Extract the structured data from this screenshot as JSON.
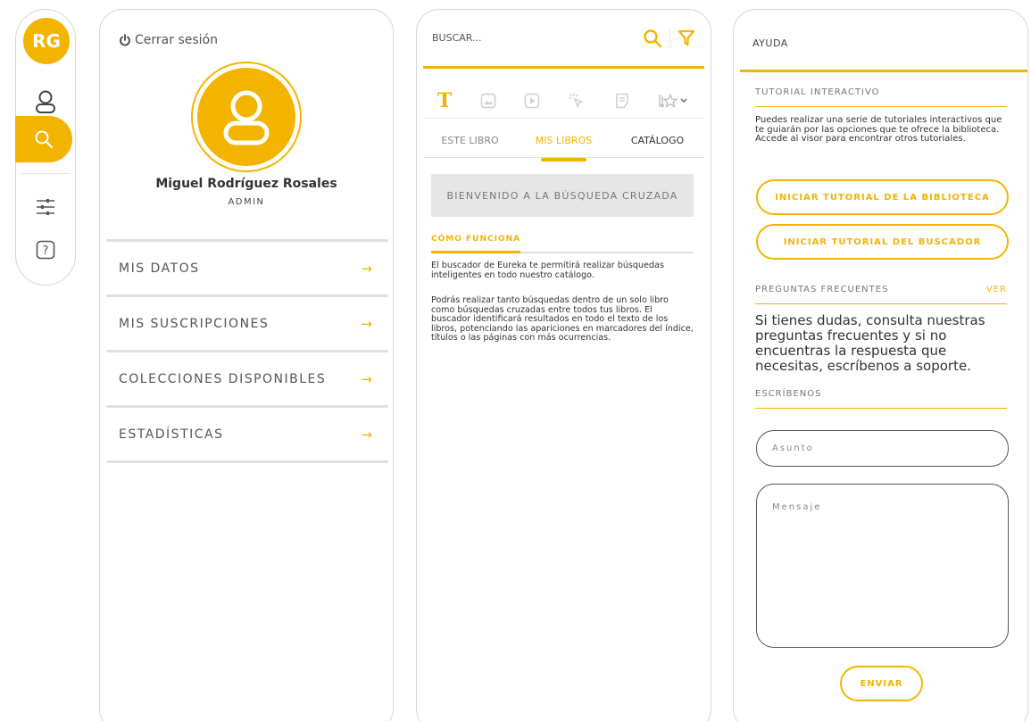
{
  "theme": {
    "accent": "#f3b400",
    "border": "#d7d7d7",
    "muted": "#777777"
  },
  "rail": {
    "initials": "RG",
    "items": [
      {
        "icon": "user-icon"
      },
      {
        "icon": "search-icon",
        "active": true
      },
      {
        "icon": "sliders-icon"
      },
      {
        "icon": "help-icon"
      }
    ]
  },
  "profile": {
    "logout_label": "Cerrar sesión",
    "name": "Miguel Rodríguez Rosales",
    "role": "ADMIN",
    "menu": [
      {
        "label": "MIS DATOS"
      },
      {
        "label": "MIS SUSCRIPCIONES"
      },
      {
        "label": "COLECCIONES DISPONIBLES"
      },
      {
        "label": "ESTADÍSTICAS"
      }
    ],
    "arrow": "→"
  },
  "search": {
    "placeholder": "BUSCAR...",
    "tools": [
      "text",
      "image",
      "video",
      "click",
      "note",
      "favorites"
    ],
    "text_tool_glyph": "T",
    "tabs": [
      {
        "label": "ESTE LIBRO"
      },
      {
        "label": "MIS LIBROS",
        "active": true
      },
      {
        "label": "CATÁLOGO"
      }
    ],
    "welcome": "BIENVENIDO A LA BÚSQUEDA CRUZADA",
    "how_title": "CÓMO FUNCIONA",
    "paragraph1": "El buscador de Eureka te permitirá realizar búsquedas inteligentes en todo nuestro catálogo.",
    "paragraph2": "Podrás realizar tanto búsquedas dentro de un solo libro como búsquedas cruzadas entre todos tus libros. El buscador identificará resultados en todo el texto de los libros, potenciando las apariciones en marcadores del índice, títulos o las páginas con más ocurrencias."
  },
  "help": {
    "title": "AYUDA",
    "tutorial_title": "TUTORIAL INTERACTIVO",
    "tutorial_text": "Puedes realizar una serie de tutoriales interactivos que te guiarán por las opciones que te ofrece la biblioteca. Accede al visor para encontrar otros tutoriales.",
    "tutorial_library_button": "INICIAR TUTORIAL DE LA BIBLIOTECA",
    "tutorial_search_button": "INICIAR TUTORIAL DEL BUSCADOR",
    "faq_title": "PREGUNTAS FRECUENTES",
    "faq_link": "VER",
    "faq_text": "Si tienes dudas, consulta nuestras preguntas frecuentes y si no encuentras la respuesta que necesitas, escríbenos a soporte.",
    "contact_title": "ESCRÍBENOS",
    "subject_placeholder": "Asunto",
    "message_placeholder": "Mensaje",
    "send_button": "ENVIAR"
  }
}
